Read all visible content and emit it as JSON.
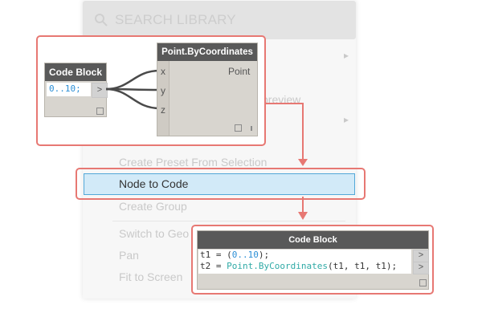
{
  "search": {
    "placeholder": "SEARCH LIBRARY"
  },
  "menu": {
    "items": [
      {
        "label": "Create Preset From Selection"
      },
      {
        "label": "Node to Code"
      },
      {
        "label": "Create Group"
      },
      {
        "label": "Switch to Geo"
      },
      {
        "label": "Pan"
      },
      {
        "label": "Fit to Screen"
      }
    ],
    "partial_item": "preview"
  },
  "before": {
    "code_block": {
      "title": "Code Block",
      "code": "0..10;",
      "out_port": ">"
    },
    "point_node": {
      "title": "Point.ByCoordinates",
      "inputs": [
        "x",
        "y",
        "z"
      ],
      "output": "Point"
    }
  },
  "after": {
    "code_block": {
      "title": "Code Block",
      "lines": [
        {
          "var": "t1",
          "op": " = (",
          "range": "0..10",
          "end": ");"
        },
        {
          "var": "t2",
          "op": " = ",
          "func": "Point.ByCoordinates",
          "args": "(t1, t1, t1);"
        }
      ],
      "out_ports": [
        ">",
        ">"
      ]
    }
  },
  "colors": {
    "callout": "#e77873",
    "highlight_bg": "#d2eaf8",
    "highlight_border": "#52a7d8",
    "number": "#2c8fd6",
    "func": "#2faaa6"
  }
}
